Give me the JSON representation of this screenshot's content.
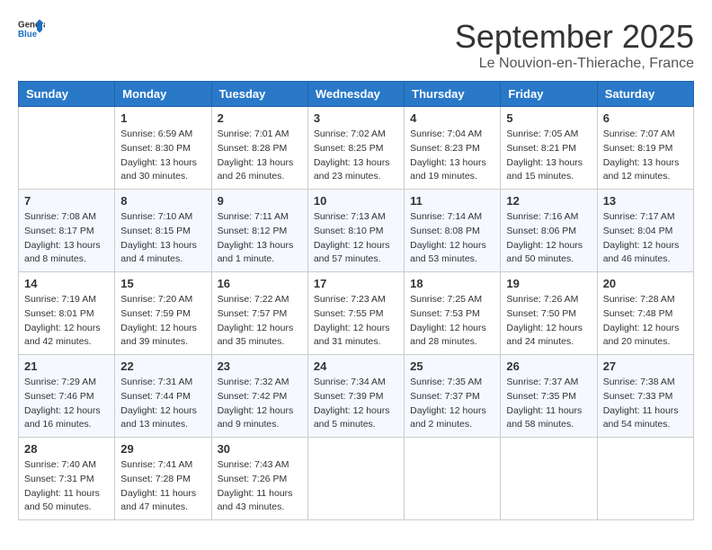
{
  "header": {
    "logo": {
      "text_general": "General",
      "text_blue": "Blue"
    },
    "month": "September 2025",
    "location": "Le Nouvion-en-Thierache, France"
  },
  "days_of_week": [
    "Sunday",
    "Monday",
    "Tuesday",
    "Wednesday",
    "Thursday",
    "Friday",
    "Saturday"
  ],
  "weeks": [
    [
      {
        "day": "",
        "info": ""
      },
      {
        "day": "1",
        "info": "Sunrise: 6:59 AM\nSunset: 8:30 PM\nDaylight: 13 hours\nand 30 minutes."
      },
      {
        "day": "2",
        "info": "Sunrise: 7:01 AM\nSunset: 8:28 PM\nDaylight: 13 hours\nand 26 minutes."
      },
      {
        "day": "3",
        "info": "Sunrise: 7:02 AM\nSunset: 8:25 PM\nDaylight: 13 hours\nand 23 minutes."
      },
      {
        "day": "4",
        "info": "Sunrise: 7:04 AM\nSunset: 8:23 PM\nDaylight: 13 hours\nand 19 minutes."
      },
      {
        "day": "5",
        "info": "Sunrise: 7:05 AM\nSunset: 8:21 PM\nDaylight: 13 hours\nand 15 minutes."
      },
      {
        "day": "6",
        "info": "Sunrise: 7:07 AM\nSunset: 8:19 PM\nDaylight: 13 hours\nand 12 minutes."
      }
    ],
    [
      {
        "day": "7",
        "info": "Sunrise: 7:08 AM\nSunset: 8:17 PM\nDaylight: 13 hours\nand 8 minutes."
      },
      {
        "day": "8",
        "info": "Sunrise: 7:10 AM\nSunset: 8:15 PM\nDaylight: 13 hours\nand 4 minutes."
      },
      {
        "day": "9",
        "info": "Sunrise: 7:11 AM\nSunset: 8:12 PM\nDaylight: 13 hours\nand 1 minute."
      },
      {
        "day": "10",
        "info": "Sunrise: 7:13 AM\nSunset: 8:10 PM\nDaylight: 12 hours\nand 57 minutes."
      },
      {
        "day": "11",
        "info": "Sunrise: 7:14 AM\nSunset: 8:08 PM\nDaylight: 12 hours\nand 53 minutes."
      },
      {
        "day": "12",
        "info": "Sunrise: 7:16 AM\nSunset: 8:06 PM\nDaylight: 12 hours\nand 50 minutes."
      },
      {
        "day": "13",
        "info": "Sunrise: 7:17 AM\nSunset: 8:04 PM\nDaylight: 12 hours\nand 46 minutes."
      }
    ],
    [
      {
        "day": "14",
        "info": "Sunrise: 7:19 AM\nSunset: 8:01 PM\nDaylight: 12 hours\nand 42 minutes."
      },
      {
        "day": "15",
        "info": "Sunrise: 7:20 AM\nSunset: 7:59 PM\nDaylight: 12 hours\nand 39 minutes."
      },
      {
        "day": "16",
        "info": "Sunrise: 7:22 AM\nSunset: 7:57 PM\nDaylight: 12 hours\nand 35 minutes."
      },
      {
        "day": "17",
        "info": "Sunrise: 7:23 AM\nSunset: 7:55 PM\nDaylight: 12 hours\nand 31 minutes."
      },
      {
        "day": "18",
        "info": "Sunrise: 7:25 AM\nSunset: 7:53 PM\nDaylight: 12 hours\nand 28 minutes."
      },
      {
        "day": "19",
        "info": "Sunrise: 7:26 AM\nSunset: 7:50 PM\nDaylight: 12 hours\nand 24 minutes."
      },
      {
        "day": "20",
        "info": "Sunrise: 7:28 AM\nSunset: 7:48 PM\nDaylight: 12 hours\nand 20 minutes."
      }
    ],
    [
      {
        "day": "21",
        "info": "Sunrise: 7:29 AM\nSunset: 7:46 PM\nDaylight: 12 hours\nand 16 minutes."
      },
      {
        "day": "22",
        "info": "Sunrise: 7:31 AM\nSunset: 7:44 PM\nDaylight: 12 hours\nand 13 minutes."
      },
      {
        "day": "23",
        "info": "Sunrise: 7:32 AM\nSunset: 7:42 PM\nDaylight: 12 hours\nand 9 minutes."
      },
      {
        "day": "24",
        "info": "Sunrise: 7:34 AM\nSunset: 7:39 PM\nDaylight: 12 hours\nand 5 minutes."
      },
      {
        "day": "25",
        "info": "Sunrise: 7:35 AM\nSunset: 7:37 PM\nDaylight: 12 hours\nand 2 minutes."
      },
      {
        "day": "26",
        "info": "Sunrise: 7:37 AM\nSunset: 7:35 PM\nDaylight: 11 hours\nand 58 minutes."
      },
      {
        "day": "27",
        "info": "Sunrise: 7:38 AM\nSunset: 7:33 PM\nDaylight: 11 hours\nand 54 minutes."
      }
    ],
    [
      {
        "day": "28",
        "info": "Sunrise: 7:40 AM\nSunset: 7:31 PM\nDaylight: 11 hours\nand 50 minutes."
      },
      {
        "day": "29",
        "info": "Sunrise: 7:41 AM\nSunset: 7:28 PM\nDaylight: 11 hours\nand 47 minutes."
      },
      {
        "day": "30",
        "info": "Sunrise: 7:43 AM\nSunset: 7:26 PM\nDaylight: 11 hours\nand 43 minutes."
      },
      {
        "day": "",
        "info": ""
      },
      {
        "day": "",
        "info": ""
      },
      {
        "day": "",
        "info": ""
      },
      {
        "day": "",
        "info": ""
      }
    ]
  ]
}
